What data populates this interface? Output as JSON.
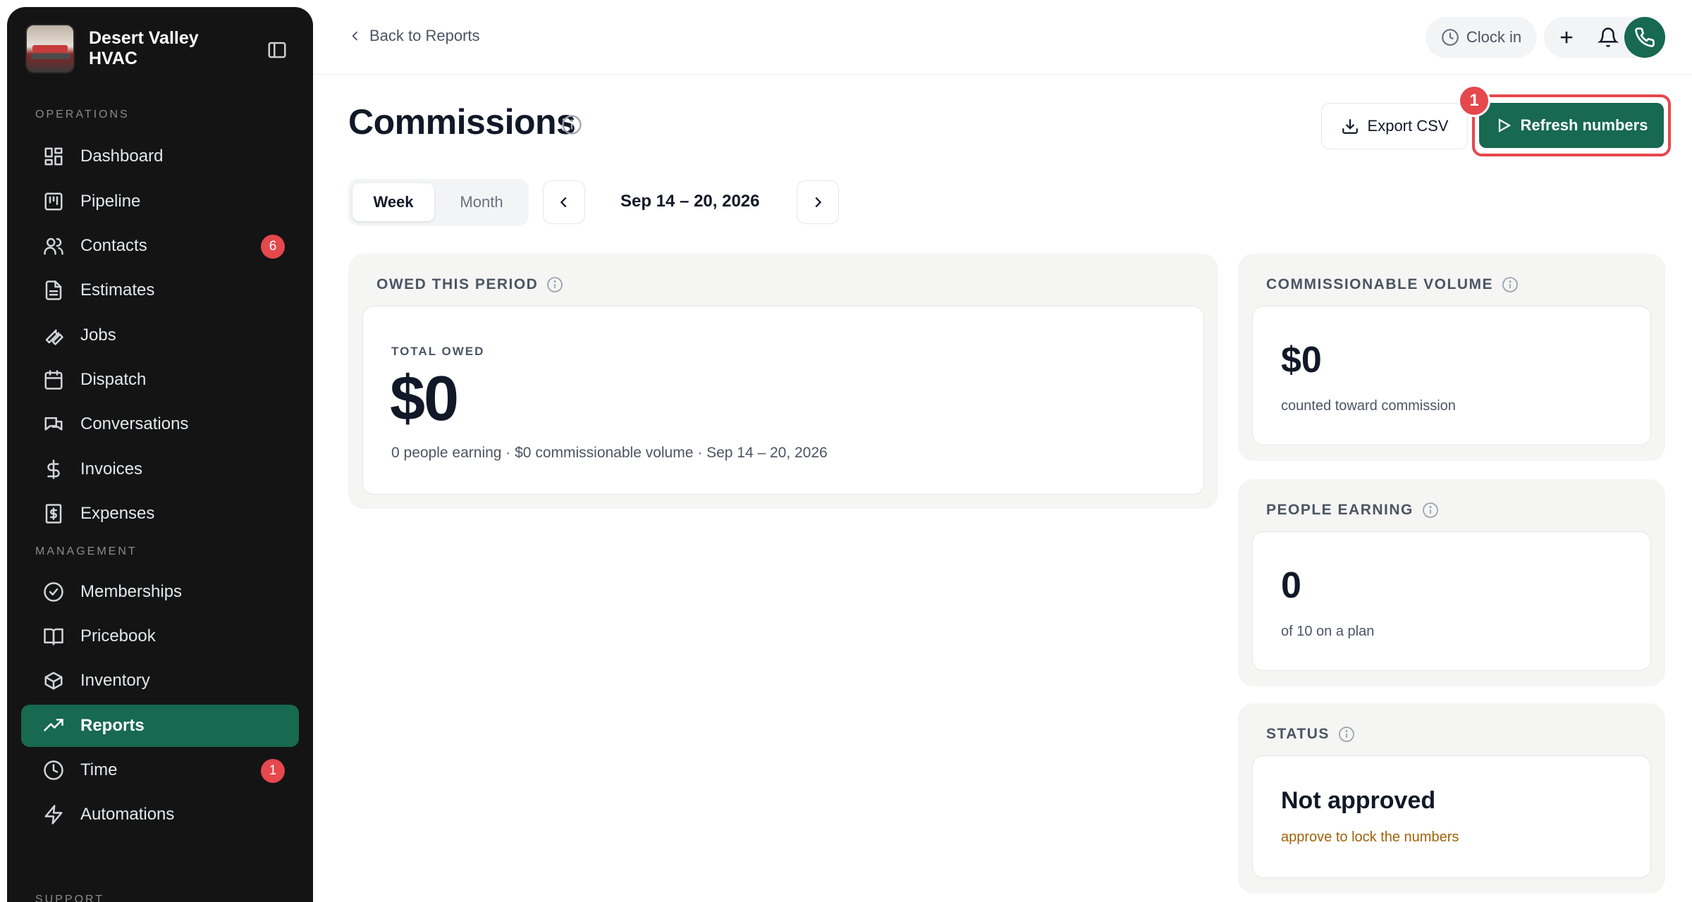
{
  "brand": {
    "name_line1": "Desert Valley",
    "name_line2": "HVAC"
  },
  "sidebar": {
    "sections": {
      "operations": "OPERATIONS",
      "management": "MANAGEMENT",
      "support": "SUPPORT"
    },
    "operations": [
      {
        "label": "Dashboard",
        "icon": "dashboard-icon"
      },
      {
        "label": "Pipeline",
        "icon": "pipeline-icon"
      },
      {
        "label": "Contacts",
        "icon": "contacts-icon",
        "badge": "6"
      },
      {
        "label": "Estimates",
        "icon": "document-icon"
      },
      {
        "label": "Jobs",
        "icon": "wrench-icon"
      },
      {
        "label": "Dispatch",
        "icon": "calendar-icon"
      },
      {
        "label": "Conversations",
        "icon": "chat-icon"
      },
      {
        "label": "Invoices",
        "icon": "dollar-icon"
      },
      {
        "label": "Expenses",
        "icon": "receipt-icon"
      }
    ],
    "management": [
      {
        "label": "Memberships",
        "icon": "check-circle-icon"
      },
      {
        "label": "Pricebook",
        "icon": "book-icon"
      },
      {
        "label": "Inventory",
        "icon": "box-icon"
      },
      {
        "label": "Reports",
        "icon": "trend-icon",
        "active": true
      },
      {
        "label": "Time",
        "icon": "clock-icon",
        "badge": "1"
      },
      {
        "label": "Automations",
        "icon": "bolt-icon"
      }
    ]
  },
  "topbar": {
    "back_label": "Back to Reports",
    "clock_in_label": "Clock in"
  },
  "header": {
    "title": "Commissions",
    "export_label": "Export CSV",
    "refresh_label": "Refresh numbers",
    "step_marker": "1"
  },
  "period": {
    "tabs": [
      "Week",
      "Month"
    ],
    "active_tab": "Week",
    "range": "Sep 14 – 20, 2026"
  },
  "cards": {
    "owed": {
      "title": "OWED THIS PERIOD",
      "caption": "TOTAL OWED",
      "value": "$0",
      "subtext": "0 people earning · $0 commissionable volume · Sep 14 – 20, 2026"
    },
    "volume": {
      "title": "COMMISSIONABLE VOLUME",
      "value": "$0",
      "subtext": "counted toward commission"
    },
    "people": {
      "title": "PEOPLE EARNING",
      "value": "0",
      "subtext": "of 10 on a plan"
    },
    "status": {
      "title": "STATUS",
      "value": "Not approved",
      "subtext": "approve to lock the numbers"
    }
  },
  "colors": {
    "brand_green": "#17694f",
    "alert_red": "#e5484d",
    "warn_text": "#a16207"
  }
}
